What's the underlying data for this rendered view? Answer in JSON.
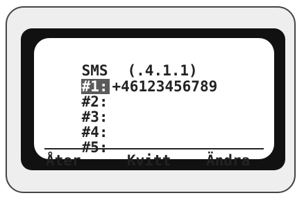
{
  "screen": {
    "title": "SMS",
    "menu_code": "(.4.1.1)",
    "entries": [
      {
        "label": "#1:",
        "value": "+46123456789"
      },
      {
        "label": "#2:",
        "value": ""
      },
      {
        "label": "#3:",
        "value": ""
      },
      {
        "label": "#4:",
        "value": ""
      },
      {
        "label": "#5:",
        "value": ""
      }
    ]
  },
  "softkeys": {
    "left": "Åter",
    "middle": "Kvitt",
    "right": "Ändra"
  },
  "colors": {
    "bezel": "#111111",
    "device_body": "#eeeeee",
    "lcd_text": "#222222",
    "selection_highlight": "#5b5b5b"
  }
}
